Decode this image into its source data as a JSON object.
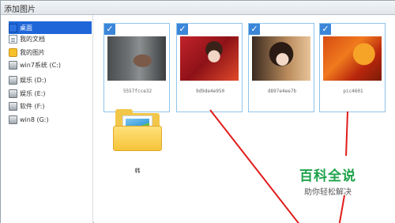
{
  "window": {
    "title": "添加图片"
  },
  "sidebar": {
    "items": [
      {
        "label": "桌面",
        "icon": "desktop-icon",
        "selected": true
      },
      {
        "label": "我的文档",
        "icon": "documents-icon",
        "selected": false
      },
      {
        "label": "我的图片",
        "icon": "pictures-icon",
        "selected": false
      },
      {
        "label": "win7系统 (C:)",
        "icon": "drive-icon",
        "selected": false
      },
      {
        "label": "娱乐 (D:)",
        "icon": "drive-icon",
        "selected": false
      },
      {
        "label": "娱乐 (E:)",
        "icon": "drive-icon",
        "selected": false
      },
      {
        "label": "软件 (F:)",
        "icon": "drive-icon",
        "selected": false
      },
      {
        "label": "win8 (G:)",
        "icon": "drive-icon",
        "selected": false
      }
    ]
  },
  "content": {
    "images": [
      {
        "caption": "5557fcce32",
        "checked": true
      },
      {
        "caption": "9d9de4e950",
        "checked": true
      },
      {
        "caption": "d897e4ee7b",
        "checked": true
      },
      {
        "caption": "pic4601",
        "checked": true
      }
    ],
    "folder": {
      "label": "韩"
    }
  },
  "watermark": {
    "title": "百科全说",
    "subtitle": "助你轻松解决"
  },
  "colors": {
    "selection": "#1f66d8",
    "check": "#3b86d8",
    "annotation": "#e01c1c",
    "watermark": "#1ea34a"
  }
}
